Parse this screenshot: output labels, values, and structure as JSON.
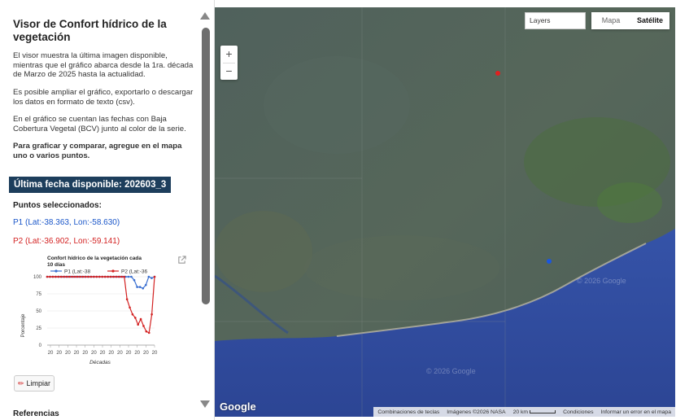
{
  "panel": {
    "title": "Visor de Confort hídrico de la vegetación",
    "paragraphs": [
      "El visor muestra la última imagen disponible, mientras que el gráfico abarca desde la 1ra. década de Marzo de 2025 hasta la actualidad.",
      "Es posible ampliar el gráfico, exportarlo o descargar los datos en formato de texto (csv).",
      "En el gráfico se cuentan las fechas con Baja Cobertura Vegetal (BCV) junto al color de la serie.",
      "Para graficar y comparar, agregue en el mapa uno o varios puntos."
    ],
    "last_date_label": "Última fecha disponible: 202603_3",
    "points_title": "Puntos seleccionados:",
    "point1": "P1 (Lat:-38.363, Lon:-58.630)",
    "point2": "P2 (Lat:-36.902, Lon:-59.141)",
    "clear_button": "Limpiar",
    "references": "Referencias"
  },
  "chart_data": {
    "type": "line",
    "title": "Confort hídrico de la vegetación cada 10 días",
    "xlabel": "Décadas",
    "ylabel": "Porcentaje",
    "ylim": [
      0,
      100
    ],
    "yticks": [
      0,
      25,
      50,
      75,
      100
    ],
    "xtick_label": "20",
    "xtick_count": 13,
    "legend_position": "top",
    "series": [
      {
        "name": "P1 (Lat:-38",
        "color": "#3a6fd1",
        "values": [
          100,
          100,
          100,
          100,
          100,
          100,
          100,
          100,
          100,
          100,
          100,
          100,
          100,
          100,
          100,
          100,
          100,
          100,
          100,
          100,
          100,
          100,
          100,
          100,
          100,
          100,
          100,
          100,
          100,
          100,
          95,
          85,
          85,
          83,
          88,
          100,
          98,
          100
        ]
      },
      {
        "name": "P2 (Lat:-36",
        "color": "#d32222",
        "values": [
          100,
          100,
          100,
          100,
          100,
          100,
          100,
          100,
          100,
          100,
          100,
          100,
          100,
          100,
          100,
          100,
          100,
          100,
          100,
          100,
          100,
          100,
          100,
          100,
          100,
          100,
          100,
          100,
          100,
          67,
          55,
          45,
          40,
          30,
          38,
          28,
          20,
          18,
          45,
          100
        ]
      }
    ]
  },
  "map": {
    "zoom_in": "+",
    "zoom_out": "−",
    "layers_label": "Layers",
    "maptype_map": "Mapa",
    "maptype_satellite": "Satélite",
    "google_logo": "Google",
    "attribution": [
      "Combinaciones de teclas",
      "Imágenes ©2026 NASA",
      "20 km",
      "Condiciones",
      "Informar un error en el mapa"
    ],
    "watermark": "© 2026 Google",
    "marker_p1_color": "#1a56e0",
    "marker_p2_color": "#e02020"
  }
}
